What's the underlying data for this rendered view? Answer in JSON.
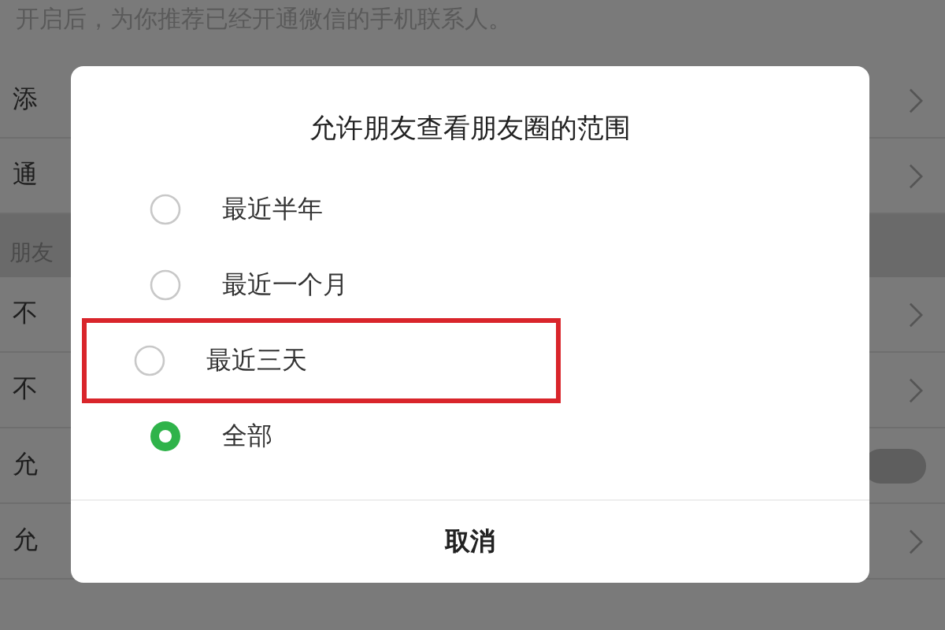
{
  "hint": "开启后，为你推荐已经开通微信的手机联系人。",
  "rows": [
    {
      "kind": "chevron",
      "label": "添"
    },
    {
      "kind": "chevron",
      "label": "通"
    },
    {
      "kind": "section",
      "label": "朋友"
    },
    {
      "kind": "chevron",
      "label": "不"
    },
    {
      "kind": "chevron",
      "label": "不"
    },
    {
      "kind": "toggle",
      "label": "允",
      "on": false
    },
    {
      "kind": "chevron",
      "label": "允"
    }
  ],
  "dialog": {
    "title": "允许朋友查看朋友圈的范围",
    "options": [
      {
        "label": "最近半年",
        "selected": false,
        "highlighted": false
      },
      {
        "label": "最近一个月",
        "selected": false,
        "highlighted": false
      },
      {
        "label": "最近三天",
        "selected": false,
        "highlighted": true
      },
      {
        "label": "全部",
        "selected": true,
        "highlighted": false
      }
    ],
    "cancel": "取消"
  }
}
